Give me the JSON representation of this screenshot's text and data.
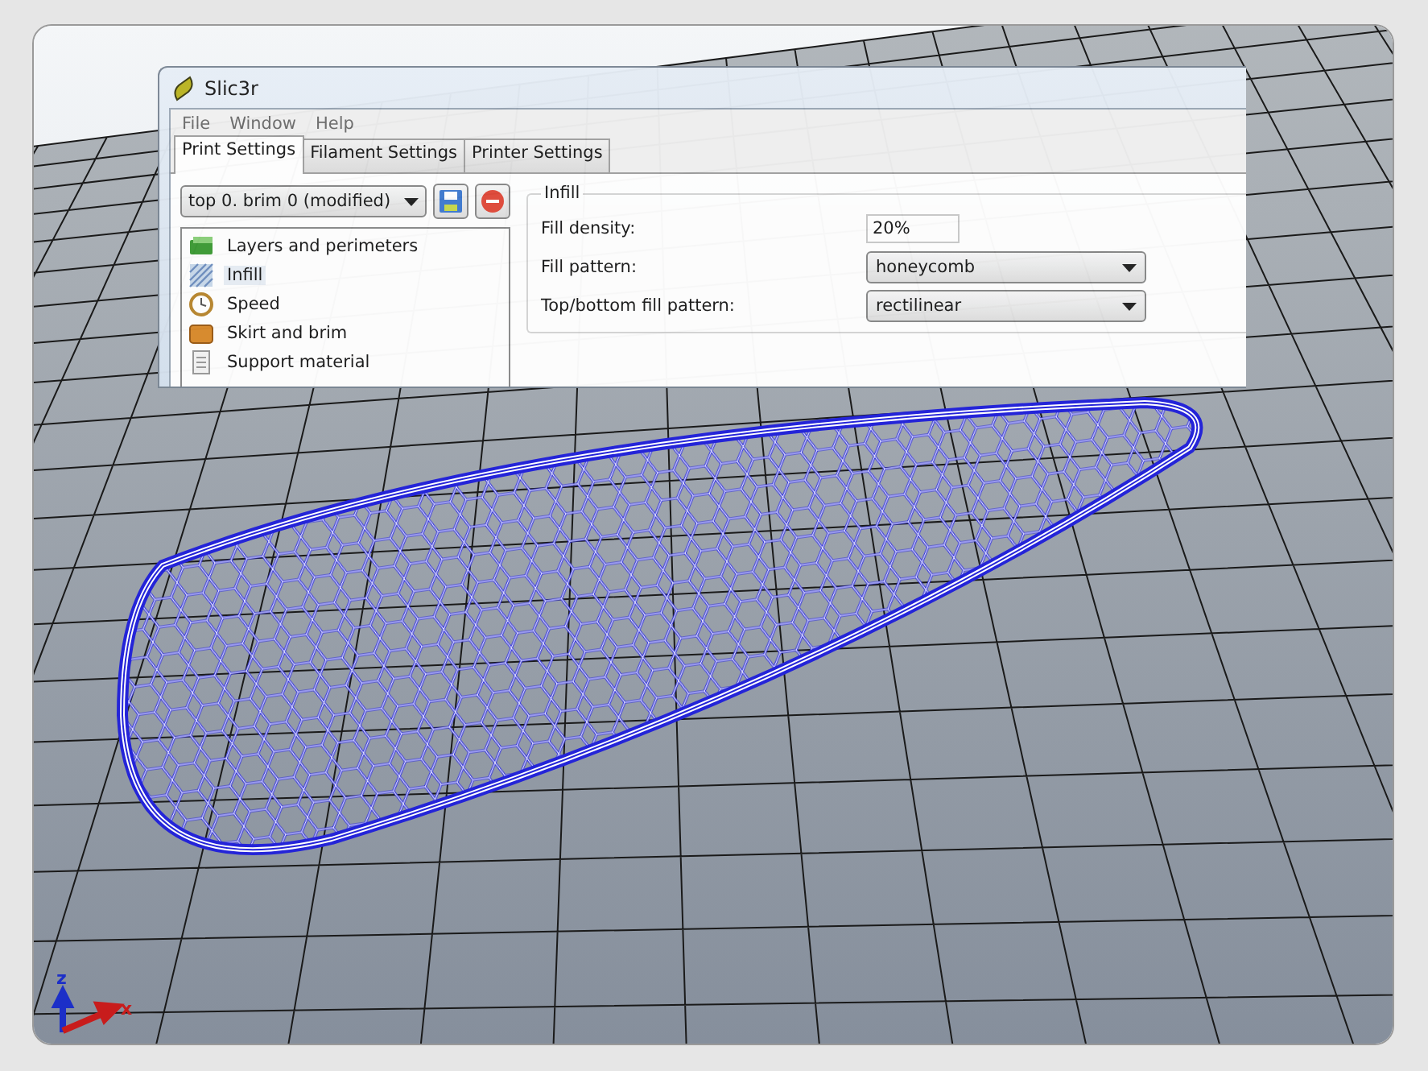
{
  "window": {
    "title": "Slic3r",
    "menu": [
      "File",
      "Window",
      "Help"
    ],
    "tabs": [
      {
        "label": "Print Settings",
        "selected": true
      },
      {
        "label": "Filament Settings",
        "selected": false
      },
      {
        "label": "Printer Settings",
        "selected": false
      }
    ],
    "preset": {
      "value": "top 0. brim 0 (modified)"
    },
    "categories": [
      {
        "label": "Layers and perimeters",
        "kind": "layers",
        "selected": false
      },
      {
        "label": "Infill",
        "kind": "infill",
        "selected": true
      },
      {
        "label": "Speed",
        "kind": "speed",
        "selected": false
      },
      {
        "label": "Skirt and brim",
        "kind": "skirt",
        "selected": false
      },
      {
        "label": "Support material",
        "kind": "support",
        "selected": false
      }
    ],
    "section": {
      "title": "Infill",
      "fields": [
        {
          "label": "Fill density:",
          "kind": "text",
          "value": "20%"
        },
        {
          "label": "Fill pattern:",
          "kind": "select",
          "value": "honeycomb"
        },
        {
          "label": "Top/bottom fill pattern:",
          "kind": "select",
          "value": "rectilinear"
        }
      ]
    }
  },
  "axes": {
    "z_label": "z",
    "x_label": "x"
  }
}
